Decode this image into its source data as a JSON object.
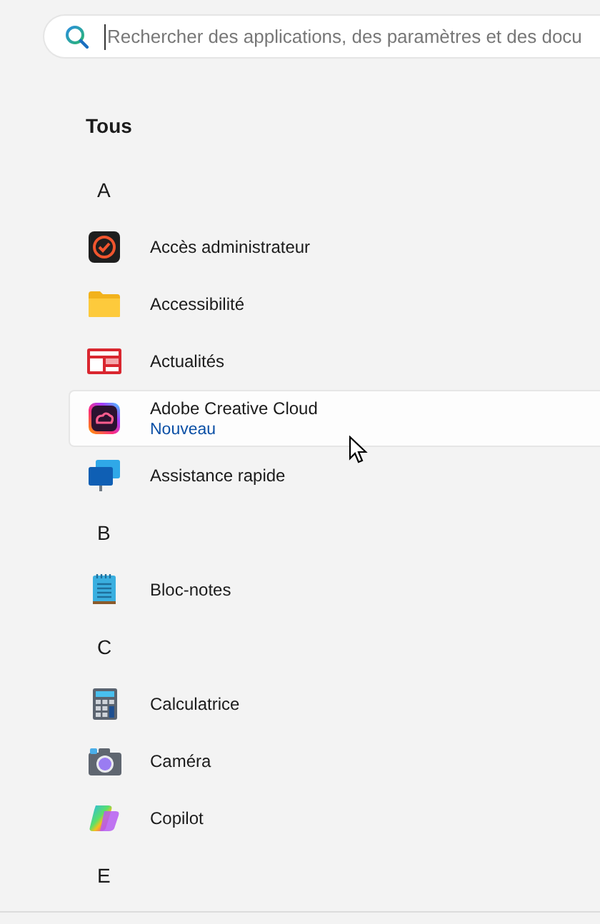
{
  "search": {
    "placeholder": "Rechercher des applications, des paramètres et des docu"
  },
  "section_title": "Tous",
  "items": [
    {
      "kind": "letter",
      "label": "A"
    },
    {
      "kind": "app",
      "label": "Accès administrateur",
      "hovered": false
    },
    {
      "kind": "app",
      "label": "Accessibilité",
      "hovered": false
    },
    {
      "kind": "app",
      "label": "Actualités",
      "hovered": false
    },
    {
      "kind": "app",
      "label": "Adobe Creative Cloud",
      "badge": "Nouveau",
      "hovered": true
    },
    {
      "kind": "app",
      "label": "Assistance rapide",
      "hovered": false
    },
    {
      "kind": "letter",
      "label": "B"
    },
    {
      "kind": "app",
      "label": "Bloc-notes",
      "hovered": false
    },
    {
      "kind": "letter",
      "label": "C"
    },
    {
      "kind": "app",
      "label": "Calculatrice",
      "hovered": false
    },
    {
      "kind": "app",
      "label": "Caméra",
      "hovered": false
    },
    {
      "kind": "app",
      "label": "Copilot",
      "hovered": false
    },
    {
      "kind": "letter",
      "label": "E"
    }
  ]
}
